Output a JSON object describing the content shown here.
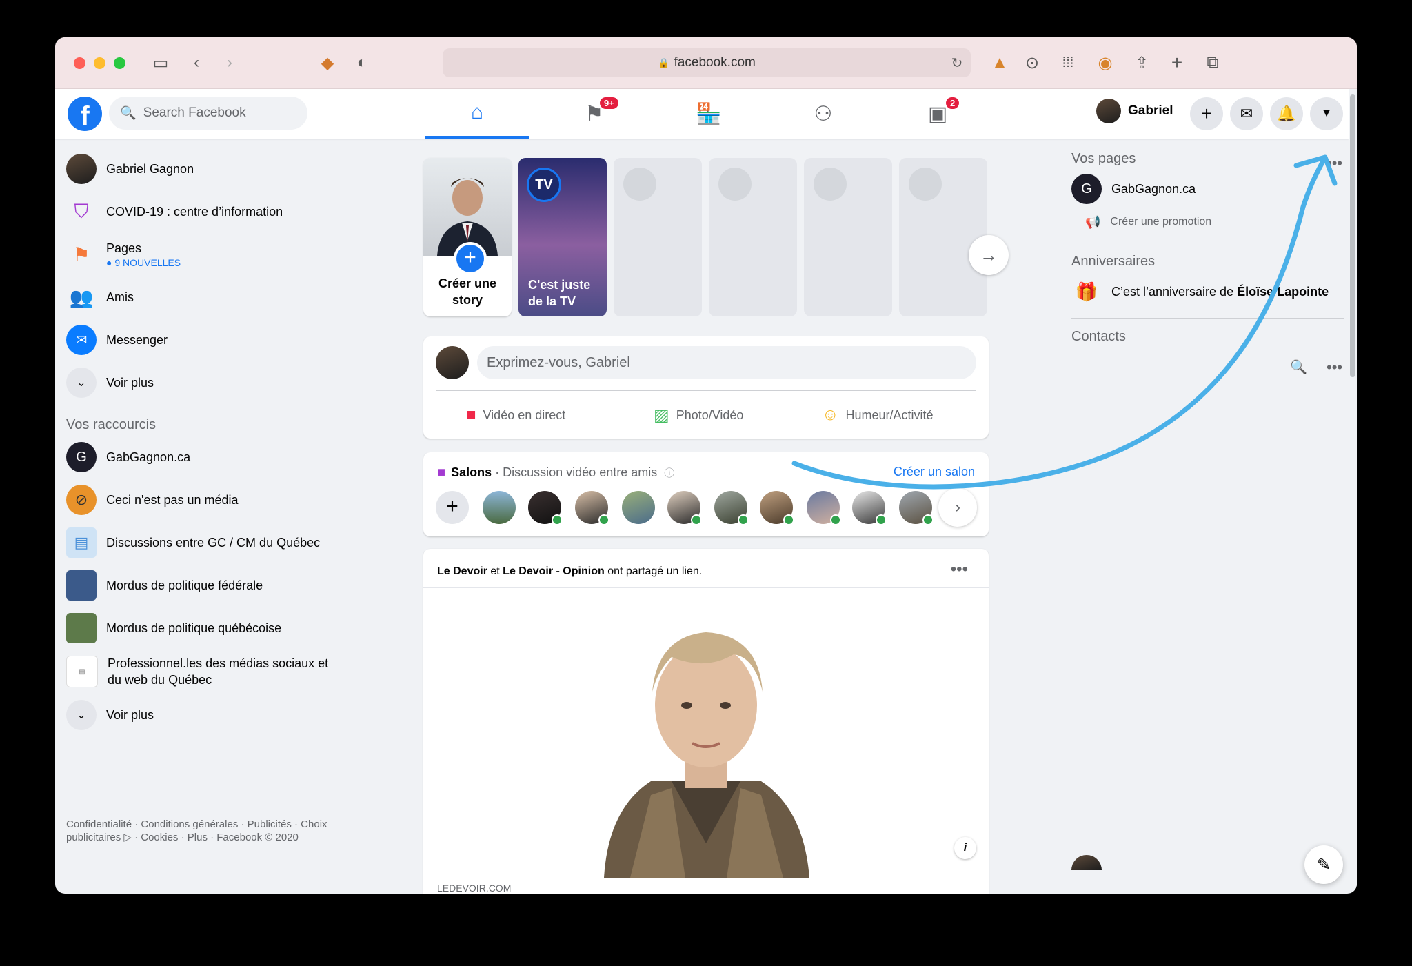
{
  "browser": {
    "url": "facebook.com"
  },
  "header": {
    "search_placeholder": "Search Facebook",
    "notif_badge_pages": "9+",
    "notif_badge_gaming": "2",
    "profile_name": "Gabriel"
  },
  "left": {
    "items": [
      {
        "label": "Gabriel Gagnon"
      },
      {
        "label": "COVID-19 : centre d’information"
      },
      {
        "label": "Pages",
        "sub": "9 NOUVELLES"
      },
      {
        "label": "Amis"
      },
      {
        "label": "Messenger"
      },
      {
        "label": "Voir plus"
      }
    ],
    "shortcuts_title": "Vos raccourcis",
    "shortcuts": [
      {
        "label": "GabGagnon.ca"
      },
      {
        "label": "Ceci n'est pas un média"
      },
      {
        "label": "Discussions entre GC / CM du Québec"
      },
      {
        "label": "Mordus de politique fédérale"
      },
      {
        "label": "Mordus de politique québécoise"
      },
      {
        "label": "Professionnel.les des médias sociaux et du web du Québec"
      }
    ],
    "shortcuts_more": "Voir plus",
    "footer": "Confidentialité · Conditions générales · Publicités · Choix publicitaires ▷ · Cookies · Plus · Facebook © 2020"
  },
  "stories": {
    "create_label": "Créer une story",
    "tv_label": "C'est juste de la TV",
    "tv_logo": "TV"
  },
  "composer": {
    "placeholder": "Exprimez-vous, Gabriel",
    "actions": [
      "Vidéo en direct",
      "Photo/Vidéo",
      "Humeur/Activité"
    ]
  },
  "rooms": {
    "title": "Salons",
    "subtitle": "· Discussion vidéo entre amis",
    "create": "Créer un salon"
  },
  "post": {
    "author1": "Le Devoir",
    "connector": "et",
    "author2": "Le Devoir - Opinion",
    "action": "ont partagé un lien.",
    "domain": "LEDEVOIR.COM"
  },
  "right": {
    "pages_title": "Vos pages",
    "page_name": "GabGagnon.ca",
    "promo": "Créer une promotion",
    "birthdays_title": "Anniversaires",
    "birthday_text": "C’est l’anniversaire de",
    "birthday_name": "Éloïse Lapointe",
    "contacts_title": "Contacts"
  },
  "colors": {
    "fb_blue": "#1877f2",
    "annotation_arrow": "#4ab0e8"
  }
}
